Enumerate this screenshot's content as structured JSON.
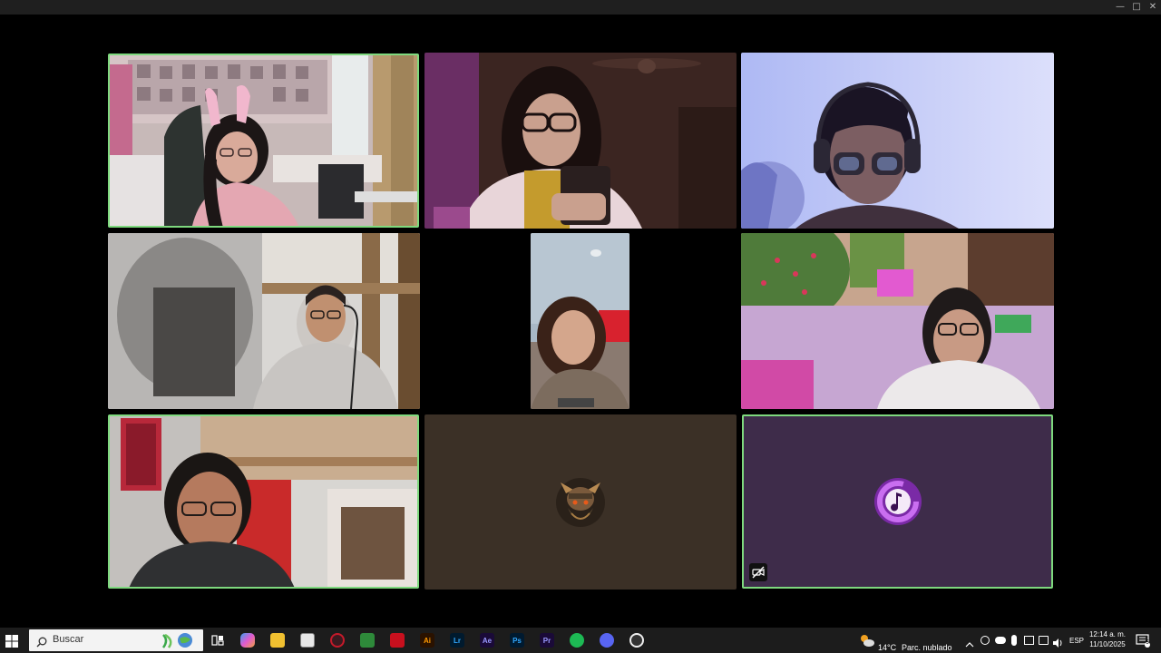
{
  "window": {
    "minimize_icon": "minimize-icon",
    "maximize_icon": "maximize-icon",
    "close_icon": "close-icon"
  },
  "gallery": {
    "participants": [
      {
        "id": "p1",
        "video": "on",
        "speaking": true
      },
      {
        "id": "p2",
        "video": "on",
        "speaking": false
      },
      {
        "id": "p3",
        "video": "on",
        "speaking": false
      },
      {
        "id": "p4",
        "video": "on",
        "speaking": false
      },
      {
        "id": "p5",
        "video": "on",
        "speaking": false
      },
      {
        "id": "p6",
        "video": "on",
        "speaking": false
      },
      {
        "id": "p7",
        "video": "on",
        "speaking": true
      },
      {
        "id": "p8",
        "video": "off",
        "avatar": "warrior-avatar-icon",
        "speaking": false
      },
      {
        "id": "p9",
        "video": "off",
        "avatar": "music-note-avatar-icon",
        "speaking": true,
        "muted_video_icon": "video-off-icon"
      }
    ],
    "colors": {
      "speaking_border": "#7ed97e",
      "tile8_bg": "#3b3026",
      "tile9_bg": "#3e2c4a",
      "avatar9_accent": "#a43ad6"
    }
  },
  "taskbar": {
    "search_placeholder": "Buscar",
    "pinned_apps": [
      "task-view-icon",
      "copilot-icon",
      "file-explorer-icon",
      "store-icon",
      "opera-icon",
      "minecraft-icon",
      "acrobat-icon",
      "illustrator-icon",
      "lightroom-icon",
      "after-effects-icon",
      "photoshop-icon",
      "premiere-icon",
      "spotify-icon",
      "discord-icon",
      "chrome-icon"
    ],
    "app_labels": {
      "acrobat": "",
      "illustrator": "Ai",
      "lightroom": "Lr",
      "after_effects": "Ae",
      "photoshop": "Ps",
      "premiere": "Pr"
    },
    "weather": {
      "temp": "14°C",
      "condition": "Parc. nublado"
    },
    "language": "ESP",
    "clock": {
      "time": "12:14 a. m.",
      "date": "11/10/2025"
    },
    "notification_count": "5"
  }
}
